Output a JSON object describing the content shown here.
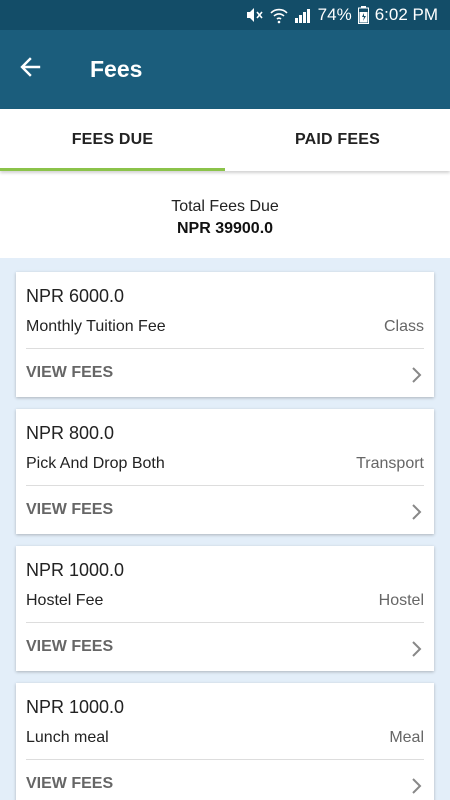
{
  "status_bar": {
    "battery": "74%",
    "time": "6:02 PM",
    "icons": [
      "mute-icon",
      "wifi-icon",
      "signal-icon",
      "battery-icon"
    ]
  },
  "app_bar": {
    "title": "Fees",
    "back_icon": "arrow-left-icon"
  },
  "tabs": [
    {
      "label": "FEES DUE",
      "active": true
    },
    {
      "label": "PAID FEES",
      "active": false
    }
  ],
  "summary": {
    "label": "Total Fees Due",
    "value": "NPR 39900.0"
  },
  "fees": [
    {
      "amount": "NPR 6000.0",
      "name": "Monthly Tuition Fee",
      "category": "Class",
      "action": "VIEW FEES"
    },
    {
      "amount": "NPR 800.0",
      "name": "Pick And Drop Both",
      "category": "Transport",
      "action": "VIEW FEES"
    },
    {
      "amount": "NPR 1000.0",
      "name": "Hostel Fee",
      "category": "Hostel",
      "action": "VIEW FEES"
    },
    {
      "amount": "NPR 1000.0",
      "name": "Lunch meal",
      "category": "Meal",
      "action": "VIEW FEES"
    }
  ],
  "colors": {
    "status_bar": "#134d68",
    "app_bar": "#1b5d7c",
    "tab_indicator": "#8bc34a",
    "list_background": "#e3eef9"
  }
}
